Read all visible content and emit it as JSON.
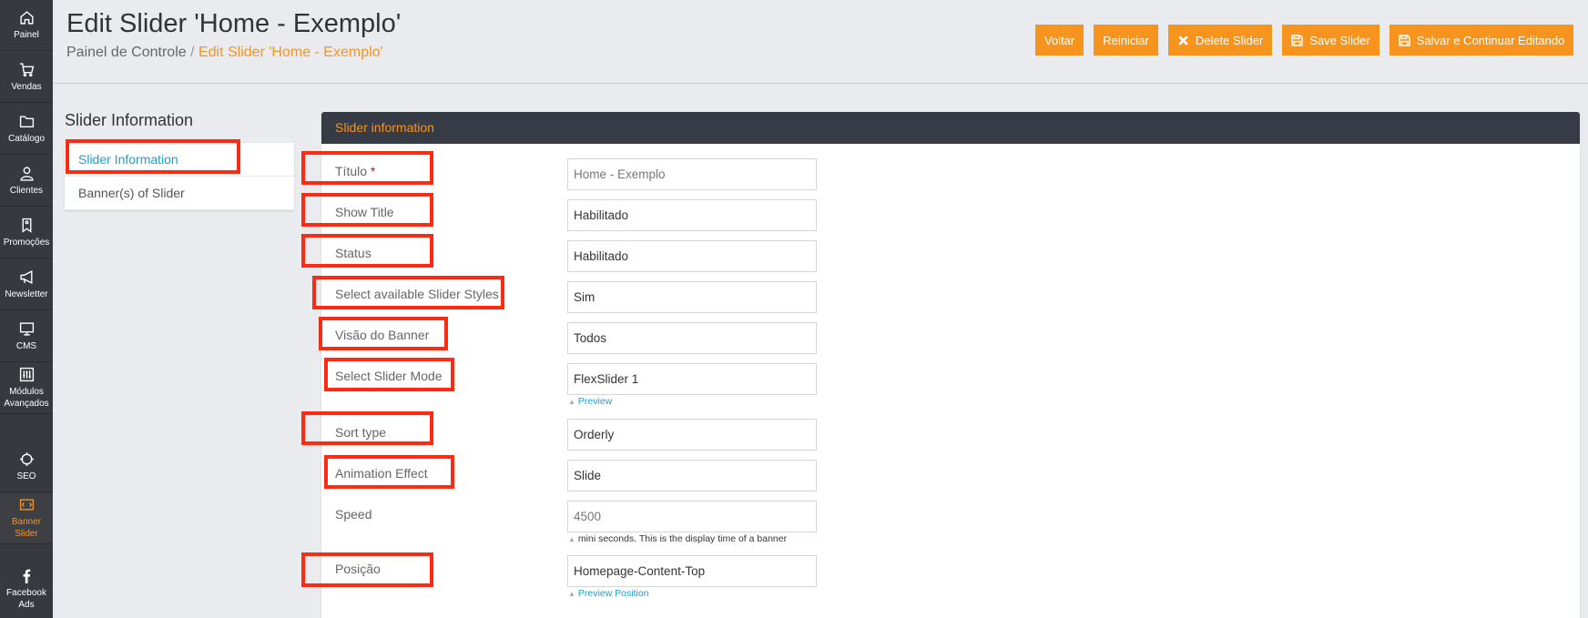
{
  "sidebar": {
    "items": [
      {
        "label": "Painel",
        "icon": "home-icon"
      },
      {
        "label": "Vendas",
        "icon": "cart-icon"
      },
      {
        "label": "Catálogo",
        "icon": "folder-icon"
      },
      {
        "label": "Clientes",
        "icon": "user-icon"
      },
      {
        "label": "Promoções",
        "icon": "tag-icon"
      },
      {
        "label": "Newsletter",
        "icon": "megaphone-icon"
      },
      {
        "label": "CMS",
        "icon": "monitor-icon"
      },
      {
        "label": "Módulos Avançados",
        "line1": "Módulos",
        "line2": "Avançados",
        "icon": "sliders-icon"
      },
      {
        "label": "SEO",
        "icon": "target-icon"
      },
      {
        "label": "Banner Slider",
        "line1": "Banner",
        "line2": "Slider",
        "icon": "banner-icon"
      },
      {
        "label": "Facebook Ads",
        "line1": "Facebook",
        "line2": "Ads",
        "icon": "facebook-icon"
      }
    ]
  },
  "header": {
    "title": "Edit Slider 'Home - Exemplo'",
    "breadcrumb": {
      "root": "Painel de Controle",
      "separator": " / ",
      "current": "Edit Slider 'Home - Exemplo'"
    }
  },
  "actions": {
    "back": "Voltar",
    "reset": "Reiniciar",
    "delete": "Delete Slider",
    "save": "Save Slider",
    "save_continue": "Salvar e Continuar Editando"
  },
  "tabs": {
    "heading": "Slider Information",
    "items": [
      "Slider Information",
      "Banner(s) of Slider"
    ]
  },
  "card": {
    "title": "Slider information"
  },
  "form": {
    "title": {
      "label": "Título",
      "required": "*",
      "value": "Home - Exemplo"
    },
    "show_title": {
      "label": "Show Title",
      "value": "Habilitado"
    },
    "status": {
      "label": "Status",
      "value": "Habilitado"
    },
    "slider_styles": {
      "label": "Select available Slider Styles",
      "value": "Sim"
    },
    "banner_view": {
      "label": "Visão do Banner",
      "value": "Todos"
    },
    "slider_mode": {
      "label": "Select Slider Mode",
      "value": "FlexSlider 1",
      "hint": "Preview"
    },
    "sort_type": {
      "label": "Sort type",
      "value": "Orderly"
    },
    "animation": {
      "label": "Animation Effect",
      "value": "Slide"
    },
    "speed": {
      "label": "Speed",
      "value": "4500",
      "hint": "mini seconds. This is the display time of a banner"
    },
    "position": {
      "label": "Posição",
      "value": "Homepage-Content-Top",
      "hint": "Preview Position"
    }
  },
  "colors": {
    "accent": "#f7941d",
    "sidebar": "#37393f",
    "card_header": "#363b45",
    "link": "#1a9fd3",
    "highlight": "#ff2a12"
  }
}
